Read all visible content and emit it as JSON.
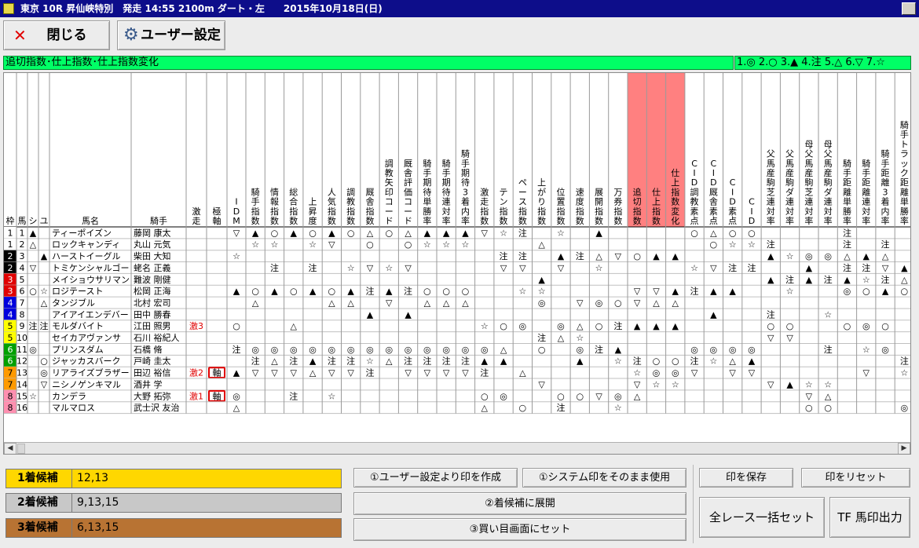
{
  "title_bar": {
    "title": "東京 10R 昇仙峡特別　発走 14:55 2100m ダート・左　　2015年10月18日(日)"
  },
  "toolbar": {
    "close_label": "閉じる",
    "close_icon": "close-x-icon",
    "user_settings_label": "ユーザー設定",
    "user_settings_icon": "gear-icon"
  },
  "colors": {
    "title_bar": "#0d0d8a",
    "chart_bar": "#00ff66",
    "highlight_header": "#ff8080",
    "candidate_1": "#ffd700",
    "candidate_2": "#c8c8c8",
    "candidate_3": "#b87333",
    "frame_colors": [
      "#ffffff",
      "#000000",
      "#e00000",
      "#0000dd",
      "#ffff00",
      "#00a000",
      "#ff9a00",
      "#ff8fb0"
    ]
  },
  "chart_title": "追切指数･仕上指数･仕上指数変化",
  "legend": "1.◎ 2.○ 3.▲ 4.注 5.△ 6.▽ 7.☆",
  "grid": {
    "headers": [
      "枠",
      "馬",
      "シ",
      "ユ",
      "馬名",
      "騎手",
      "激走",
      "極軸",
      "IDM",
      "騎手指数",
      "情報指数",
      "総合指数",
      "上昇度",
      "人気指数",
      "調教指数",
      "厩舎指数",
      "調教矢印コード",
      "厩舎評価コード",
      "騎手期待単勝率",
      "騎手期待連対率",
      "騎手期待3着内率",
      "激走指数",
      "テン指数",
      "ペース指数",
      "上がり指数",
      "位置指数",
      "速度指数",
      "展開指数",
      "万券指数",
      "追切指数",
      "仕上指数",
      "仕上指数変化",
      "CID調教素点",
      "CID厩舎素点",
      "CID素点",
      "CID",
      "父馬産駒芝連対率",
      "父馬産駒ダ連対率",
      "母父馬産駒芝連対率",
      "母父馬産駒ダ連対率",
      "騎手距離単勝率",
      "騎手距離連対率",
      "騎手距離3着内率",
      "騎手トラック距離単勝率"
    ],
    "highlighted_columns": [
      "追切指数",
      "仕上指数",
      "仕上指数変化"
    ],
    "rows": [
      {
        "waku": "1",
        "uma": "1",
        "shi": "▲",
        "yu": "",
        "name": "ティーポイズン",
        "jockey": "藤岡 康太",
        "gekiso": "",
        "jiku": "",
        "marks": [
          "▽",
          "▲",
          "○",
          "▲",
          "○",
          "▲",
          "○",
          "△",
          "○",
          "△",
          "▲",
          "▲",
          "▲",
          "▽",
          "☆",
          "注",
          "",
          "☆",
          "",
          "▲",
          "",
          "",
          "",
          "",
          "○",
          "△",
          "○",
          "○",
          "",
          "",
          "",
          "",
          "注",
          "",
          "",
          ""
        ]
      },
      {
        "waku": "1",
        "uma": "2",
        "shi": "△",
        "yu": "",
        "name": "ロックキャンディ",
        "jockey": "丸山 元気",
        "gekiso": "",
        "jiku": "",
        "marks": [
          "",
          "☆",
          "☆",
          "",
          "☆",
          "▽",
          "",
          "○",
          "",
          "○",
          "☆",
          "☆",
          "☆",
          "",
          "",
          "",
          "△",
          "",
          "",
          "",
          "",
          "",
          "",
          "",
          "",
          "○",
          "☆",
          "☆",
          "注",
          "",
          "",
          "",
          "注",
          "",
          "注",
          ""
        ]
      },
      {
        "waku": "2",
        "uma": "3",
        "shi": "",
        "yu": "▲",
        "name": "ハーストイーグル",
        "jockey": "柴田 大知",
        "gekiso": "",
        "jiku": "",
        "marks": [
          "☆",
          "",
          "",
          "",
          "",
          "",
          "",
          "",
          "",
          "",
          "",
          "",
          "",
          "",
          "注",
          "注",
          "",
          "▲",
          "注",
          "△",
          "▽",
          "○",
          "▲",
          "▲",
          "",
          "",
          "",
          "",
          "▲",
          "☆",
          "◎",
          "◎",
          "△",
          "▲",
          "△",
          ""
        ]
      },
      {
        "waku": "2",
        "uma": "4",
        "shi": "▽",
        "yu": "",
        "name": "トミケンシャルゴー",
        "jockey": "蛯名 正義",
        "gekiso": "",
        "jiku": "",
        "marks": [
          "",
          "",
          "注",
          "",
          "注",
          "",
          "☆",
          "▽",
          "☆",
          "▽",
          "",
          "",
          "",
          "",
          "▽",
          "▽",
          "",
          "▽",
          "",
          "☆",
          "",
          "",
          "",
          "",
          "☆",
          "▽",
          "注",
          "注",
          "",
          "",
          "▲",
          "",
          "注",
          "注",
          "▽",
          "▲"
        ]
      },
      {
        "waku": "3",
        "uma": "5",
        "shi": "",
        "yu": "",
        "name": "メイショウサリマン",
        "jockey": "難波 剛健",
        "gekiso": "",
        "jiku": "",
        "marks": [
          "",
          "",
          "",
          "",
          "",
          "",
          "",
          "",
          "",
          "",
          "",
          "",
          "",
          "",
          "",
          "",
          "▲",
          "",
          "",
          "",
          "",
          "",
          "",
          "",
          "",
          "",
          "",
          "",
          "▲",
          "注",
          "▲",
          "注",
          "▲",
          "☆",
          "注",
          "△"
        ]
      },
      {
        "waku": "3",
        "uma": "6",
        "shi": "○",
        "yu": "☆",
        "name": "ロジテースト",
        "jockey": "松岡 正海",
        "gekiso": "",
        "jiku": "",
        "marks": [
          "▲",
          "○",
          "▲",
          "○",
          "▲",
          "○",
          "▲",
          "注",
          "▲",
          "注",
          "○",
          "○",
          "○",
          "",
          "",
          "☆",
          "☆",
          "",
          "",
          "",
          "",
          "▽",
          "▽",
          "▲",
          "注",
          "▲",
          "▲",
          "",
          "",
          "☆",
          "",
          "",
          "◎",
          "○",
          "▲",
          "○"
        ]
      },
      {
        "waku": "4",
        "uma": "7",
        "shi": "",
        "yu": "△",
        "name": "タンジブル",
        "jockey": "北村 宏司",
        "gekiso": "",
        "jiku": "",
        "marks": [
          "",
          "△",
          "",
          "",
          "",
          "△",
          "△",
          "",
          "▽",
          "",
          "△",
          "△",
          "△",
          "",
          "",
          "",
          "◎",
          "",
          "▽",
          "◎",
          "○",
          "▽",
          "△",
          "△",
          "",
          "",
          "",
          "",
          "",
          "",
          "",
          "",
          "",
          "",
          "",
          ""
        ]
      },
      {
        "waku": "4",
        "uma": "8",
        "shi": "",
        "yu": "",
        "name": "アイアイエンデバー",
        "jockey": "田中 勝春",
        "gekiso": "",
        "jiku": "",
        "marks": [
          "",
          "",
          "",
          "",
          "",
          "",
          "",
          "▲",
          "",
          "▲",
          "",
          "",
          "",
          "",
          "",
          "",
          "",
          "",
          "",
          "",
          "",
          "",
          "",
          "",
          "",
          "▲",
          "",
          "",
          "注",
          "",
          "",
          "☆",
          "",
          "",
          "",
          ""
        ]
      },
      {
        "waku": "5",
        "uma": "9",
        "shi": "注",
        "yu": "注",
        "name": "モルダバイト",
        "jockey": "江田 照男",
        "gekiso": "激3",
        "jiku": "",
        "marks": [
          "○",
          "",
          "",
          "△",
          "",
          "",
          "",
          "",
          "",
          "",
          "",
          "",
          "",
          "☆",
          "○",
          "◎",
          "",
          "◎",
          "△",
          "○",
          "注",
          "▲",
          "▲",
          "▲",
          "",
          "",
          "",
          "",
          "○",
          "○",
          "",
          "",
          "○",
          "◎",
          "○",
          ""
        ]
      },
      {
        "waku": "5",
        "uma": "10",
        "shi": "",
        "yu": "",
        "name": "セイカアヴァンサ",
        "jockey": "石川 裕紀人",
        "gekiso": "",
        "jiku": "",
        "marks": [
          "",
          "",
          "",
          "",
          "",
          "",
          "",
          "",
          "",
          "",
          "",
          "",
          "",
          "",
          "",
          "",
          "注",
          "△",
          "☆",
          "",
          "",
          "",
          "",
          "",
          "",
          "",
          "",
          "",
          "▽",
          "▽",
          "",
          "",
          "",
          "",
          "",
          ""
        ]
      },
      {
        "waku": "6",
        "uma": "11",
        "shi": "◎",
        "yu": "",
        "name": "プリンスダム",
        "jockey": "石橋 脩",
        "gekiso": "",
        "jiku": "",
        "marks": [
          "注",
          "◎",
          "◎",
          "◎",
          "◎",
          "◎",
          "◎",
          "◎",
          "◎",
          "◎",
          "◎",
          "◎",
          "◎",
          "◎",
          "△",
          "",
          "○",
          "",
          "◎",
          "注",
          "▲",
          "",
          "",
          "",
          "◎",
          "◎",
          "◎",
          "◎",
          "",
          "",
          "",
          "注",
          "",
          "☆",
          "◎",
          ""
        ]
      },
      {
        "waku": "6",
        "uma": "12",
        "shi": "",
        "yu": "○",
        "name": "ジャッカスバーク",
        "jockey": "戸崎 圭太",
        "gekiso": "",
        "jiku": "",
        "marks": [
          "",
          "注",
          "△",
          "注",
          "▲",
          "注",
          "注",
          "☆",
          "△",
          "注",
          "注",
          "注",
          "注",
          "▲",
          "▲",
          "",
          "",
          "",
          "▲",
          "",
          "☆",
          "注",
          "○",
          "○",
          "注",
          "☆",
          "△",
          "▲",
          "",
          "",
          "",
          "",
          "",
          "",
          "",
          "注"
        ]
      },
      {
        "waku": "7",
        "uma": "13",
        "shi": "",
        "yu": "◎",
        "name": "リアライズブラザー",
        "jockey": "田辺 裕信",
        "gekiso": "激2",
        "jiku": "軸",
        "marks": [
          "▲",
          "▽",
          "▽",
          "▽",
          "△",
          "▽",
          "▽",
          "注",
          "",
          "▽",
          "▽",
          "▽",
          "▽",
          "注",
          "",
          "△",
          "",
          "",
          "",
          "",
          "",
          "☆",
          "◎",
          "◎",
          "▽",
          "",
          "▽",
          "▽",
          "",
          "",
          "",
          "",
          "",
          "▽",
          "",
          "☆"
        ]
      },
      {
        "waku": "7",
        "uma": "14",
        "shi": "",
        "yu": "▽",
        "name": "ニシノゲンキマル",
        "jockey": "酒井 学",
        "gekiso": "",
        "jiku": "",
        "marks": [
          "",
          "",
          "",
          "",
          "",
          "",
          "",
          "",
          "",
          "",
          "",
          "",
          "",
          "",
          "",
          "",
          "▽",
          "",
          "",
          "",
          "",
          "▽",
          "☆",
          "☆",
          "",
          "",
          "",
          "",
          "▽",
          "▲",
          "☆",
          "☆",
          "",
          "",
          "",
          ""
        ]
      },
      {
        "waku": "8",
        "uma": "15",
        "shi": "☆",
        "yu": "",
        "name": "カンデラ",
        "jockey": "大野 拓弥",
        "gekiso": "激1",
        "jiku": "軸",
        "marks": [
          "◎",
          "",
          "",
          "注",
          "",
          "☆",
          "",
          "",
          "",
          "",
          "",
          "",
          "",
          "○",
          "◎",
          "",
          "",
          "○",
          "○",
          "▽",
          "◎",
          "△",
          "",
          "",
          "",
          "",
          "",
          "",
          "",
          "",
          "▽",
          "△",
          "",
          "",
          "",
          ""
        ]
      },
      {
        "waku": "8",
        "uma": "16",
        "shi": "",
        "yu": "",
        "name": "マルマロス",
        "jockey": "武士沢 友治",
        "gekiso": "",
        "jiku": "",
        "marks": [
          "△",
          "",
          "",
          "",
          "",
          "",
          "",
          "",
          "",
          "",
          "",
          "",
          "",
          "△",
          "",
          "○",
          "",
          "注",
          "",
          "",
          "☆",
          "",
          "",
          "",
          "",
          "",
          "",
          "",
          "",
          "",
          "○",
          "○",
          "",
          "",
          "",
          "◎"
        ]
      }
    ]
  },
  "candidates": [
    {
      "label": "1着候補",
      "value": "12,13"
    },
    {
      "label": "2着候補",
      "value": "9,13,15"
    },
    {
      "label": "3着候補",
      "value": "6,13,15"
    }
  ],
  "actions": {
    "create_from_user": "①ユーザー設定より印を作成",
    "use_system": "①システム印をそのまま使用",
    "save_marks": "印を保存",
    "reset_marks": "印をリセット",
    "expand": "②着候補に展開",
    "bet_screen": "③買い目画面にセット",
    "all_race_set": "全レース一括セット",
    "tf_output": "TF 馬印出力"
  }
}
